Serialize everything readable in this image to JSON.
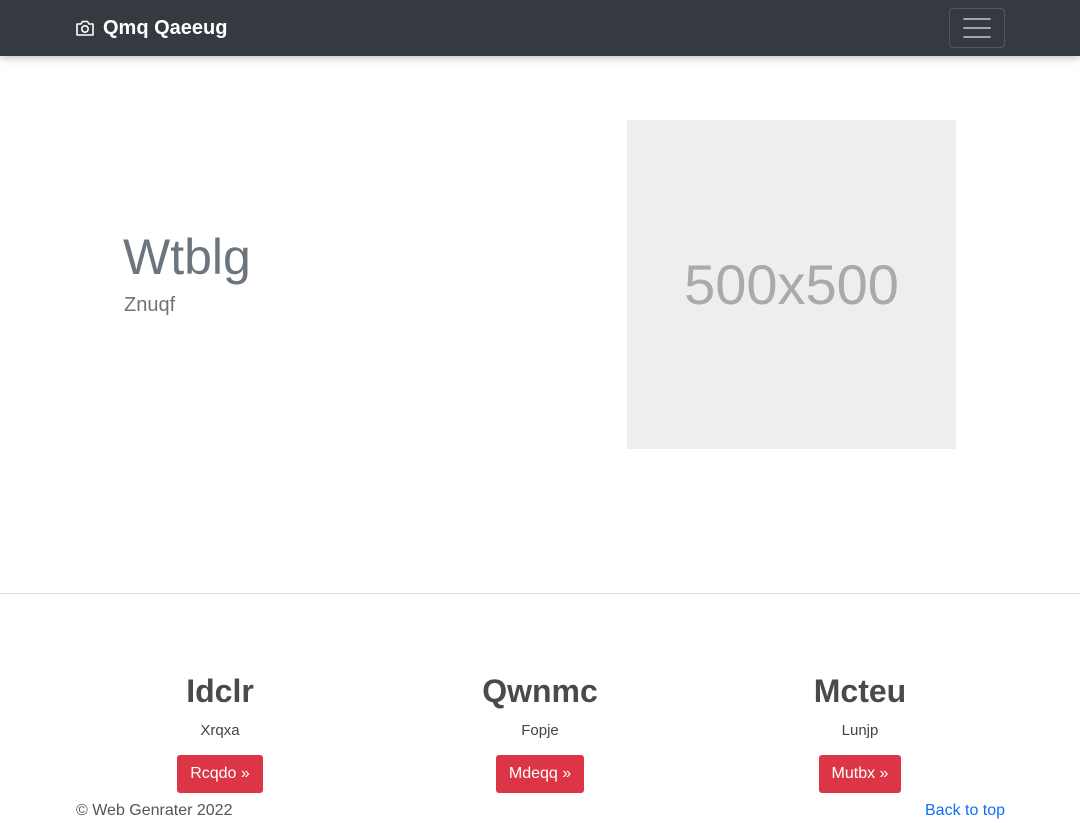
{
  "navbar": {
    "brand": "Qmq Qaeeug",
    "brand_icon": "camera-icon",
    "toggler_icon": "hamburger-menu-icon"
  },
  "hero": {
    "title": "Wtblg",
    "subtitle": "Znuqf",
    "image_placeholder": "500x500"
  },
  "features": [
    {
      "title": "Idclr",
      "text": "Xrqxa",
      "button": "Rcqdo »"
    },
    {
      "title": "Qwnmc",
      "text": "Fopje",
      "button": "Mdeqq »"
    },
    {
      "title": "Mcteu",
      "text": "Lunjp",
      "button": "Mutbx »"
    }
  ],
  "footer": {
    "copyright": "© Web Genrater 2022",
    "back_to_top": "Back to top"
  },
  "colors": {
    "navbar_bg": "#343a40",
    "button_bg": "#dc3545",
    "link": "#0d6efd",
    "placeholder_bg": "#eeeeee"
  }
}
